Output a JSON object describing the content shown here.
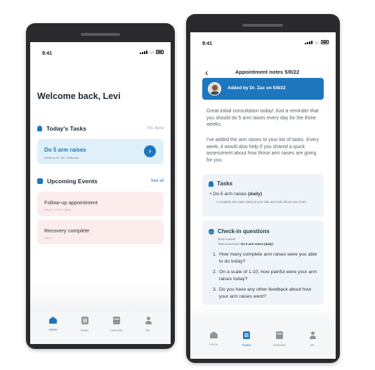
{
  "left_phone": {
    "status_time": "9:41",
    "greeting": "Welcome back, Levi",
    "todays_tasks": {
      "title": "Today's Tasks",
      "count": "0/1 done",
      "task": {
        "title": "Do 5 arm raises",
        "subtitle": "Added by Dr. Zac • Daily task"
      }
    },
    "upcoming_events": {
      "title": "Upcoming Events",
      "see_all": "See all",
      "events": [
        {
          "title": "Follow-up appointment",
          "subtitle": "May 20, 12:00-1:30pm"
        },
        {
          "title": "Recovery complete",
          "subtitle": "June 1"
        }
      ]
    },
    "tabs": [
      {
        "label": "Home",
        "icon": "home-icon",
        "active": true
      },
      {
        "label": "Notes",
        "icon": "notes-icon",
        "active": false
      },
      {
        "label": "Calendar",
        "icon": "calendar-icon",
        "active": false
      },
      {
        "label": "Me",
        "icon": "person-icon",
        "active": false
      }
    ]
  },
  "right_phone": {
    "status_time": "9:41",
    "title": "Appointment notes 5/8/22",
    "banner": "Added by Dr. Zac on 5/8/22",
    "paragraph1": "Great initial consultation today! Just a reminder that you should do 5 arm raises every day for the three weeks.",
    "paragraph2": "I've added the arm raises to your list of tasks. Every week, it would also help if you shared a quick assessment about how those arm raises are going for you.",
    "tasks_box": {
      "title": "Tasks",
      "item_prefix": "Do 5 arm raises",
      "item_freq": "(daily)",
      "item_note": "A complete arm raise starts at your side and ends above your head."
    },
    "checkin_box": {
      "title": "Check-in questions",
      "frequency": "Once a week",
      "task_label": "Task associated:",
      "task_value": "Do 5 arm raises (daily)",
      "questions": [
        "How many complete arm raises were you able to do today?",
        "On a scale of 1-10, how painful were your arm raises today?",
        "Do you have any other feedback about how your arm raises went?"
      ]
    },
    "tabs": [
      {
        "label": "Home",
        "icon": "home-icon",
        "active": false
      },
      {
        "label": "Notes",
        "icon": "notes-icon",
        "active": true
      },
      {
        "label": "Calendar",
        "icon": "calendar-icon",
        "active": false
      },
      {
        "label": "Me",
        "icon": "person-icon",
        "active": false
      }
    ]
  },
  "colors": {
    "accent": "#1e76bd",
    "task_bg": "#dff0fb",
    "event_bg": "#fdecec",
    "box_bg": "#eef4f9",
    "phone_frame": "#2a2a2c"
  }
}
